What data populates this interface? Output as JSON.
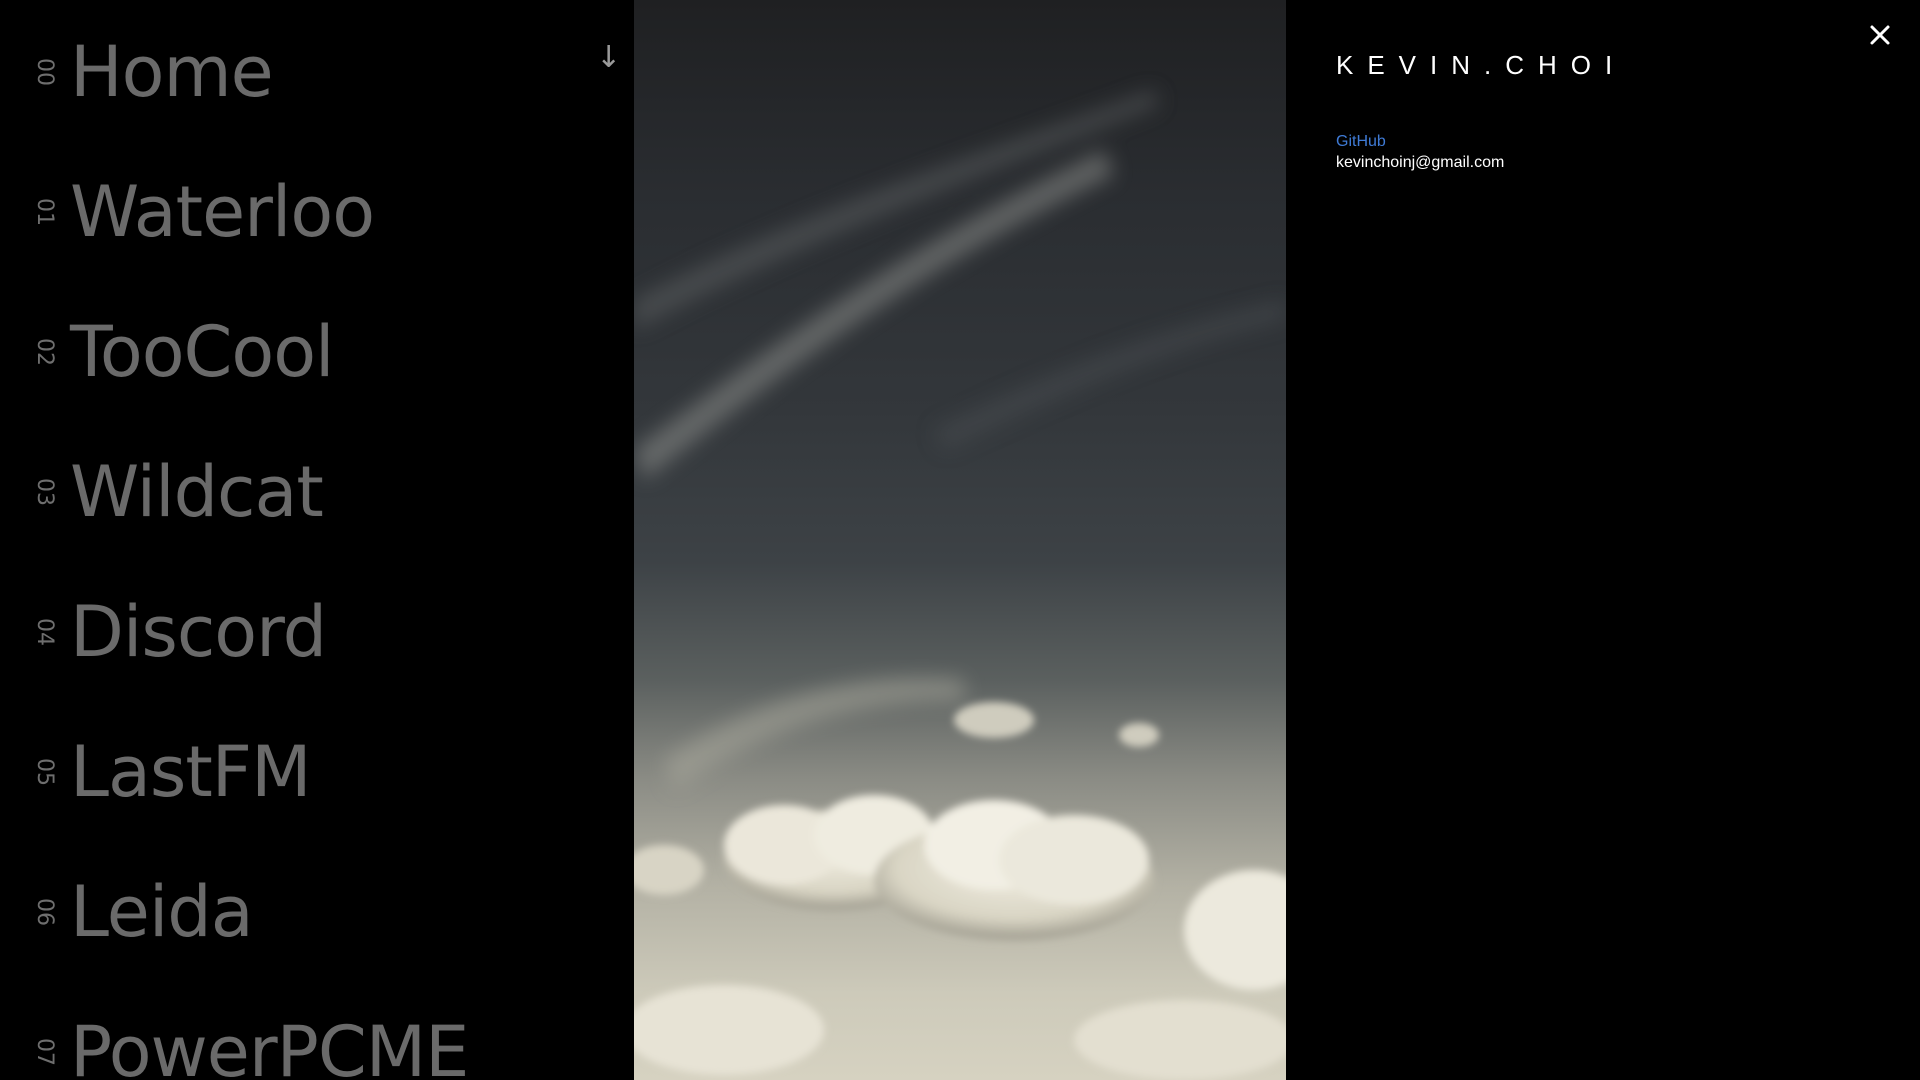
{
  "nav": {
    "items": [
      {
        "num": "00",
        "label": "Home"
      },
      {
        "num": "01",
        "label": "Waterloo"
      },
      {
        "num": "02",
        "label": "TooCool"
      },
      {
        "num": "03",
        "label": "Wildcat"
      },
      {
        "num": "04",
        "label": "Discord"
      },
      {
        "num": "05",
        "label": "LastFM"
      },
      {
        "num": "06",
        "label": "Leida"
      },
      {
        "num": "07",
        "label": "PowerPCME"
      }
    ],
    "scroll_icon": "arrow-down-icon",
    "scroll_glyph": "↓"
  },
  "panel": {
    "brand": "KEVIN.CHOI",
    "github_label": "GitHub",
    "email": "kevinchoinj@gmail.com",
    "close_icon": "close-icon"
  },
  "colors": {
    "background": "#000000",
    "nav_text": "#6a6a6a",
    "link": "#3f7bd6",
    "brand": "#ffffff"
  }
}
